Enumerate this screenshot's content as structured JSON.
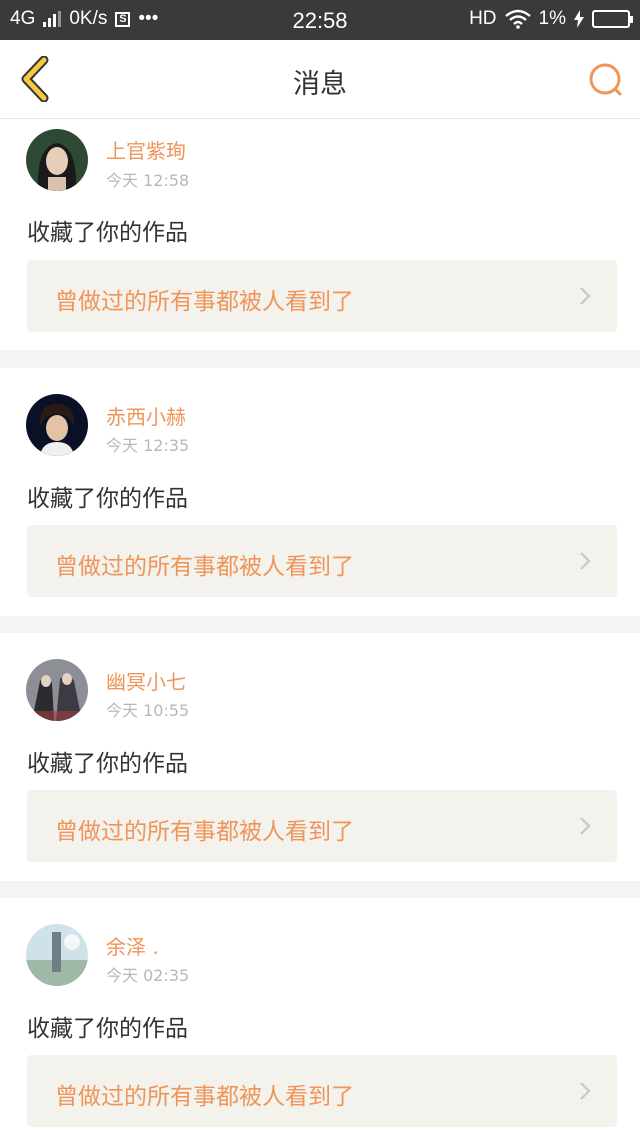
{
  "status_bar": {
    "network": "4G",
    "speed": "0K/s",
    "time": "22:58",
    "hd": "HD",
    "battery": "1%"
  },
  "header": {
    "title": "消息"
  },
  "colors": {
    "accent": "#f0955a",
    "back_icon": "#f5c842",
    "quote_bg": "#f3f2ed"
  },
  "messages": [
    {
      "name": "上官紫珣",
      "time": "今天 12:58",
      "action": "收藏了你的作品",
      "quote": "曾做过的所有事都被人看到了"
    },
    {
      "name": "赤西小赫",
      "time": "今天 12:35",
      "action": "收藏了你的作品",
      "quote": "曾做过的所有事都被人看到了"
    },
    {
      "name": "幽冥小七",
      "time": "今天 10:55",
      "action": "收藏了你的作品",
      "quote": "曾做过的所有事都被人看到了"
    },
    {
      "name": "余泽 .",
      "time": "今天 02:35",
      "action": "收藏了你的作品",
      "quote": "曾做过的所有事都被人看到了"
    }
  ]
}
